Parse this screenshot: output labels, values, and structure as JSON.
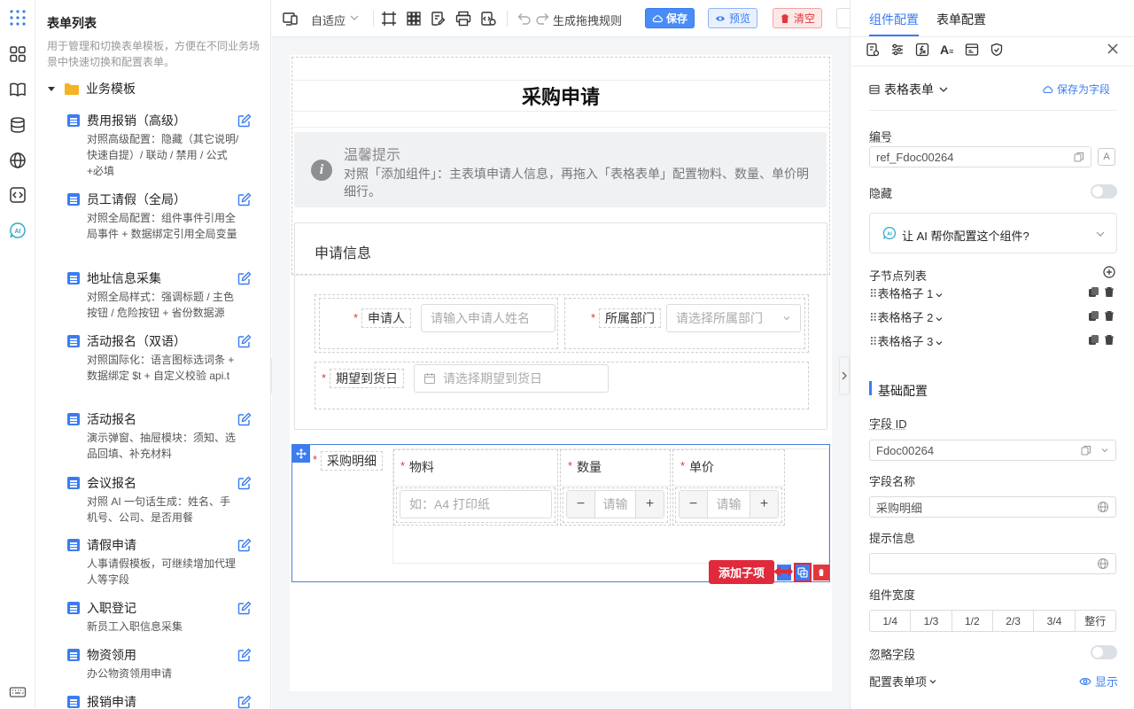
{
  "left_panel": {
    "title": "表单列表",
    "description": "用于管理和切换表单模板，方便在不同业务场景中快速切换和配置表单。",
    "folder": "业务模板",
    "templates": [
      {
        "name": "费用报销（高级）",
        "desc": "对照高级配置：隐藏（其它说明/快速自提）/ 联动 / 禁用 / 公式+必填"
      },
      {
        "name": "员工请假（全局）",
        "desc": "对照全局配置：组件事件引用全局事件 + 数据绑定引用全局变量"
      },
      {
        "name": "地址信息采集",
        "desc": "对照全局样式：强调标题 / 主色按钮 / 危险按钮 + 省份数据源"
      },
      {
        "name": "活动报名（双语）",
        "desc": "对照国际化：语言图标选词条 + 数据绑定 $t + 自定义校验 api.t"
      },
      {
        "name": "活动报名",
        "desc": "演示弹窗、抽屉模块：须知、选品回填、补充材料"
      },
      {
        "name": "会议报名",
        "desc": "对照 AI 一句话生成：姓名、手机号、公司、是否用餐"
      },
      {
        "name": "请假申请",
        "desc": "人事请假模板，可继续增加代理人等字段"
      },
      {
        "name": "入职登记",
        "desc": "新员工入职信息采集"
      },
      {
        "name": "物资领用",
        "desc": "办公物资领用申请"
      },
      {
        "name": "报销申请",
        "desc": ""
      }
    ]
  },
  "toolbar": {
    "adapt_label": "自适应",
    "gen_rule_label": "生成拖拽规则",
    "save_label": "保存",
    "preview_label": "预览",
    "clear_label": "清空"
  },
  "form": {
    "title": "采购申请",
    "tip_title": "温馨提示",
    "tip_text": "对照「添加组件」：主表填申请人信息，再拖入「表格表单」配置物料、数量、单价明细行。",
    "section_title": "申请信息",
    "applicant_label": "申请人",
    "applicant_placeholder": "请输入申请人姓名",
    "dept_label": "所属部门",
    "dept_placeholder": "请选择所属部门",
    "date_label": "期望到货日",
    "date_placeholder": "请选择期望到货日",
    "detail_label": "采购明细",
    "col_material": "物料",
    "col_qty": "数量",
    "col_price": "单价",
    "material_placeholder": "如：A4 打印纸",
    "qty_placeholder": "请输",
    "price_placeholder": "请输",
    "minus": "−",
    "plus": "+",
    "add_child_tooltip": "添加子项"
  },
  "right_panel": {
    "tab_component": "组件配置",
    "tab_form": "表单配置",
    "component_type": "表格表单",
    "save_as_field": "保存为字段",
    "id_label": "编号",
    "id_value": "ref_Fdoc00264",
    "hidden_label": "隐藏",
    "ai_prompt": "让 AI 帮你配置这个组件?",
    "ai_badge": "AI",
    "children_label": "子节点列表",
    "children": [
      "表格格子 1",
      "表格格子 2",
      "表格格子 3"
    ],
    "basic_config": "基础配置",
    "field_id_label": "字段 ID",
    "field_id_value": "Fdoc00264",
    "field_name_label": "字段名称",
    "field_name_value": "采购明细",
    "hint_label": "提示信息",
    "hint_value": "",
    "width_label": "组件宽度",
    "width_options": [
      "1/4",
      "1/3",
      "1/2",
      "2/3",
      "3/4",
      "整行"
    ],
    "ignore_label": "忽略字段",
    "config_items_label": "配置表单项",
    "show_label": "显示",
    "text_icon_letter": "A"
  },
  "rail": {
    "ai_badge": "AI"
  },
  "colors": {
    "primary": "#3b7cf2",
    "save_button": "#4a8cf7",
    "preview_bg": "#e8f0fd",
    "clear_bg": "#fde8e8",
    "danger": "#e0383e",
    "tooltip": "#e02a3c",
    "selected_border": "#4a7fe0"
  }
}
